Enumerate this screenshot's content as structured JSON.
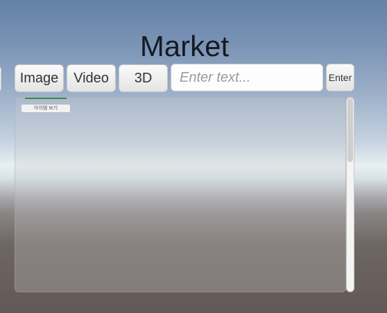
{
  "title": "Market",
  "buttons": {
    "image": "Image",
    "video": "Video",
    "three_d": "3D",
    "enter": "Enter"
  },
  "search": {
    "placeholder": "Enter text..."
  },
  "list": {
    "items": [
      {
        "label": "아이템 보기"
      }
    ]
  }
}
